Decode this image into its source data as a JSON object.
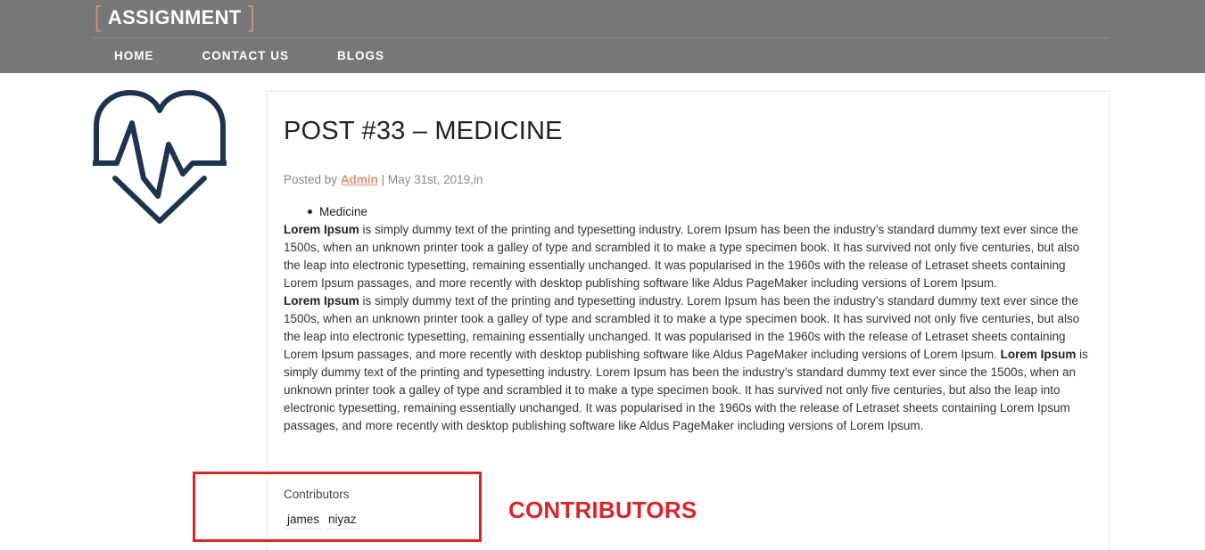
{
  "header": {
    "brand": {
      "bracket_open": "[",
      "name": "ASSIGNMENT",
      "bracket_close": "]"
    },
    "nav": [
      {
        "label": "HOME"
      },
      {
        "label": "CONTACT US"
      },
      {
        "label": "BLOGS"
      }
    ]
  },
  "sidebar": {
    "logo_icon": "heart-pulse-icon"
  },
  "post": {
    "title": "POST #33 – MEDICINE",
    "meta": {
      "posted_by": "Posted by",
      "author": "Admin",
      "separator": "|",
      "date_in": "May 31st, 2019,in"
    },
    "categories": [
      "Medicine"
    ],
    "paragraphs": [
      {
        "bold": "Lorem Ipsum",
        "text": " is simply dummy text of the printing and typesetting industry. Lorem Ipsum has been the industry’s standard dummy text ever since the 1500s, when an unknown printer took a galley of type and scrambled it to make a type specimen book. It has survived not only five centuries, but also the leap into electronic typesetting, remaining essentially unchanged. It was popularised in the 1960s with the release of Letraset sheets containing Lorem Ipsum passages, and more recently with desktop publishing software like Aldus PageMaker including versions of Lorem Ipsum."
      },
      {
        "bold": "Lorem Ipsum",
        "text": " is simply dummy text of the printing and typesetting industry. Lorem Ipsum has been the industry’s standard dummy text ever since the 1500s, when an unknown printer took a galley of type and scrambled it to make a type specimen book. It has survived not only five centuries, but also the leap into electronic typesetting, remaining essentially unchanged. It was popularised in the 1960s with the release of Letraset sheets containing Lorem Ipsum passages, and more recently with desktop publishing software like Aldus PageMaker including versions of Lorem Ipsum. ",
        "bold2": "Lorem Ipsum",
        "text2": " is simply dummy text of the printing and typesetting industry. Lorem Ipsum has been the industry’s standard dummy text ever since the 1500s, when an unknown printer took a galley of type and scrambled it to make a type specimen book. It has survived not only five centuries, but also the leap into electronic typesetting, remaining essentially unchanged. It was popularised in the 1960s with the release of Letraset sheets containing Lorem Ipsum passages, and more recently with desktop publishing software like Aldus PageMaker including versions of Lorem Ipsum."
      }
    ],
    "contributors": {
      "label": "Contributors",
      "names": [
        "james",
        "niyaz"
      ]
    }
  },
  "annotation": {
    "label": "CONTRIBUTORS",
    "color": "#d8262c"
  },
  "colors": {
    "header_bg": "#777777",
    "accent": "#e4907a",
    "logo_stroke": "#1d3350"
  }
}
